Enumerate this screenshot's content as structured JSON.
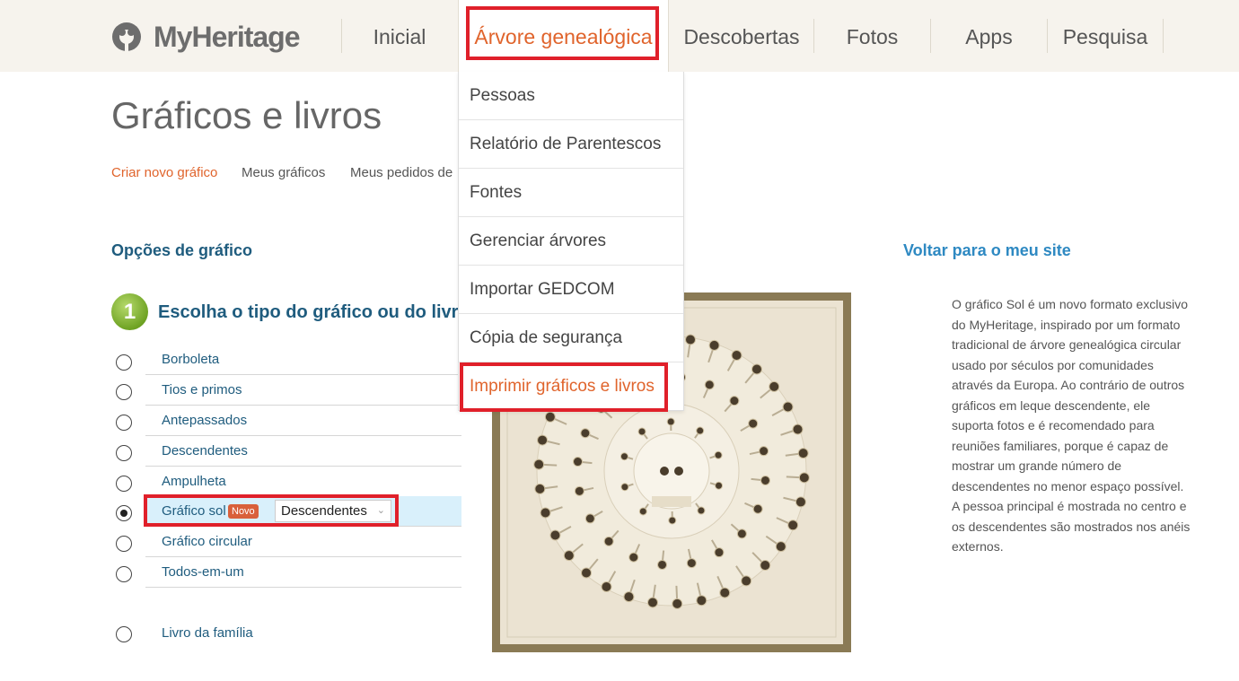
{
  "header": {
    "logo_text": "MyHeritage",
    "nav": [
      {
        "label": "Inicial"
      },
      {
        "label": "Árvore genealógica"
      },
      {
        "label": "Descobertas"
      },
      {
        "label": "Fotos"
      },
      {
        "label": "Apps"
      },
      {
        "label": "Pesquisa"
      }
    ],
    "active_nav": "Árvore genealógica"
  },
  "dropdown": {
    "items": [
      {
        "label": "Pessoas"
      },
      {
        "label": "Relatório de Parentescos"
      },
      {
        "label": "Fontes"
      },
      {
        "label": "Gerenciar árvores"
      },
      {
        "label": "Importar GEDCOM"
      },
      {
        "label": "Cópia de segurança"
      },
      {
        "label": "Imprimir gráficos e livros"
      }
    ],
    "active_item": "Imprimir gráficos e livros"
  },
  "page": {
    "title": "Gráficos e livros",
    "subnav": [
      {
        "label": "Criar novo gráfico"
      },
      {
        "label": "Meus gráficos"
      },
      {
        "label": "Meus pedidos de p"
      }
    ],
    "section_heading": "Opções de gráfico",
    "back_link": "Voltar para o meu site",
    "step_number": "1",
    "step_title": "Escolha o tipo do gráfico ou do livro",
    "options": [
      {
        "label": "Borboleta",
        "checked": false
      },
      {
        "label": "Tios e primos",
        "checked": false
      },
      {
        "label": "Antepassados",
        "checked": false
      },
      {
        "label": "Descendentes",
        "checked": false
      },
      {
        "label": "Ampulheta",
        "checked": false
      },
      {
        "label": "Gráfico sol",
        "checked": true,
        "badge": "Novo",
        "select_value": "Descendentes"
      },
      {
        "label": "Gráfico circular",
        "checked": false
      },
      {
        "label": "Todos-em-um",
        "checked": false
      }
    ],
    "book_option": {
      "label": "Livro da família",
      "checked": false
    },
    "description": "O gráfico Sol é um novo formato exclusivo do MyHeritage, inspirado por um formato tradicional de árvore genealógica circular usado por séculos por comunidades através da Europa. Ao contrário de outros gráficos em leque descendente, ele suporta fotos e é recomendado para reuniões familiares, porque é capaz de mostrar um grande número de descendentes no menor espaço possível. A pessoa principal é mostrada no centro e os descendentes são mostrados nos anéis externos."
  },
  "colors": {
    "accent": "#e0642c",
    "heading": "#1f5c7e",
    "link": "#2e89c2",
    "highlight_box": "#e0202a",
    "topbar_bg": "#f6f3ed"
  }
}
